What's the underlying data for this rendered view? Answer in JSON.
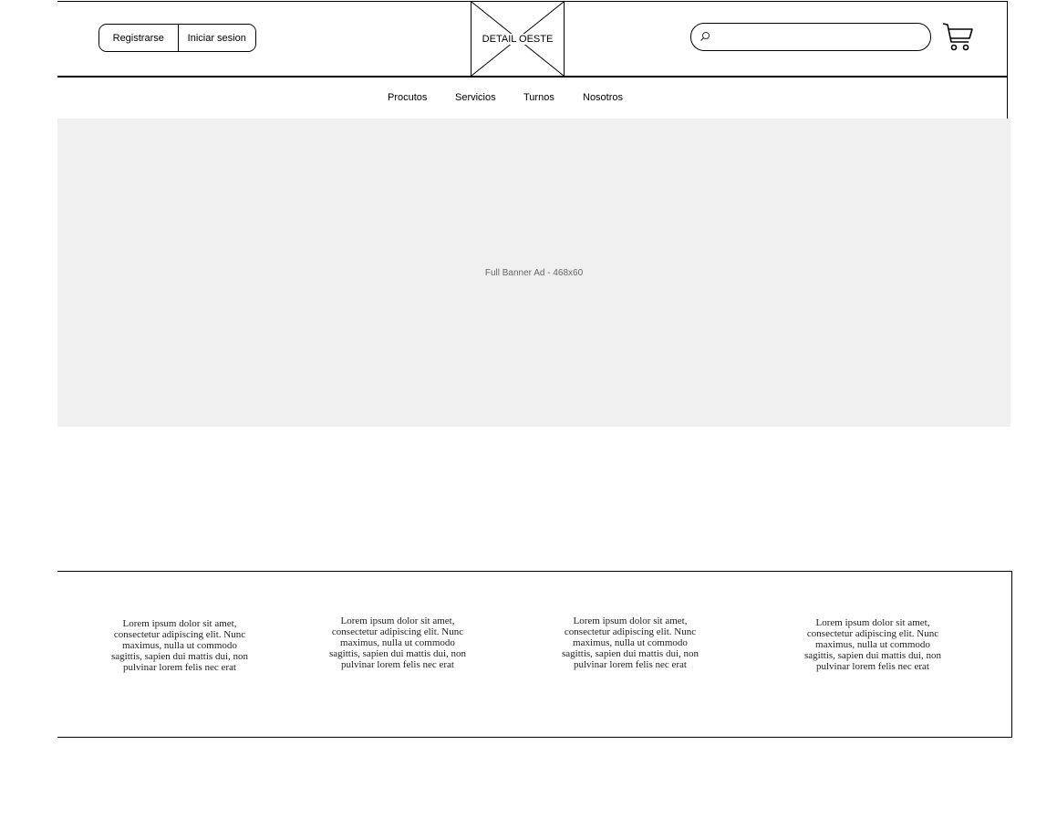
{
  "header": {
    "register_label": "Registrarse",
    "login_label": "Iniciar sesion",
    "logo_text": "DETAIL OESTE",
    "search_placeholder": "",
    "search_icon": "search-icon",
    "cart_icon": "shopping-cart-icon"
  },
  "nav": {
    "items": [
      {
        "label": "Procutos"
      },
      {
        "label": "Servicios"
      },
      {
        "label": "Turnos"
      },
      {
        "label": "Nosotros"
      }
    ]
  },
  "banner": {
    "label": "Full Banner Ad - 468x60",
    "background": "#f0f0f0",
    "label_color": "#666666"
  },
  "features": {
    "items": [
      {
        "text": "Lorem ipsum dolor sit amet, consectetur adipiscing elit. Nunc maximus, nulla ut commodo sagittis, sapien dui mattis dui, non pulvinar lorem felis nec erat"
      },
      {
        "text": "Lorem ipsum dolor sit amet, consectetur adipiscing elit. Nunc maximus, nulla ut commodo sagittis, sapien dui mattis dui, non pulvinar lorem felis nec erat"
      },
      {
        "text": "Lorem ipsum dolor sit amet, consectetur adipiscing elit. Nunc maximus, nulla ut commodo sagittis, sapien dui mattis dui, non pulvinar lorem felis nec erat"
      },
      {
        "text": "Lorem ipsum dolor sit amet, consectetur adipiscing elit. Nunc maximus, nulla ut commodo sagittis, sapien dui mattis dui, non pulvinar lorem felis nec erat"
      }
    ]
  }
}
